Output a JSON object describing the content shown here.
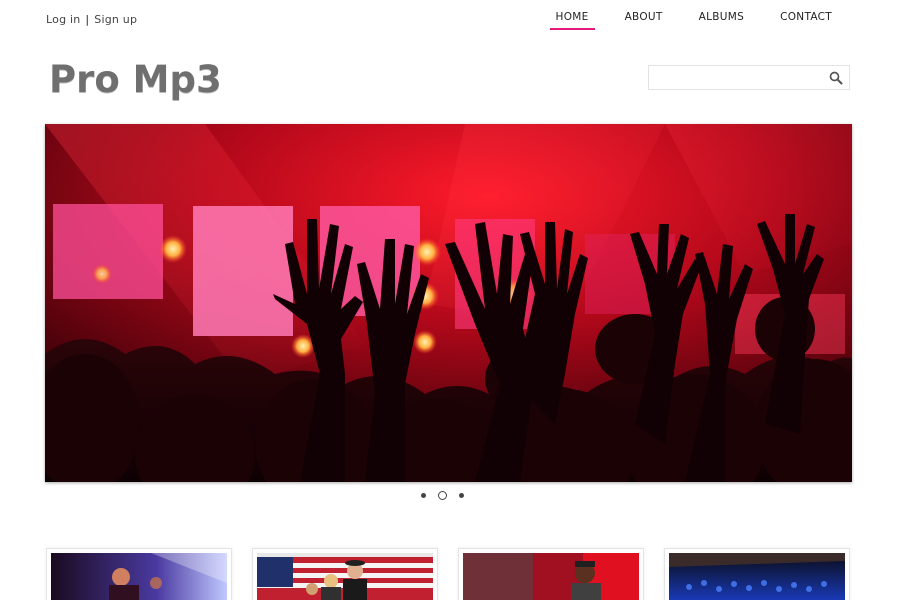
{
  "auth": {
    "login": "Log in",
    "separator": "|",
    "signup": "Sign up"
  },
  "nav": {
    "items": [
      {
        "label": "HOME",
        "active": true
      },
      {
        "label": "ABOUT",
        "active": false
      },
      {
        "label": "ALBUMS",
        "active": false
      },
      {
        "label": "CONTACT",
        "active": false
      }
    ]
  },
  "logo": {
    "text": "Pro Mp3"
  },
  "search": {
    "placeholder": "",
    "value": "",
    "icon": "search-icon"
  },
  "hero": {
    "image": "concert-crowd-raised-hands-red-lights",
    "slides": 3,
    "active_slide": 2
  },
  "albums": [
    {
      "image": "guitarist-on-stage-purple-lights"
    },
    {
      "image": "band-performing-with-american-flag"
    },
    {
      "image": "singer-with-red-backdrop"
    },
    {
      "image": "concert-crowd-blue-lights"
    }
  ],
  "colors": {
    "accent": "#e5197a",
    "logo": "#6f6f6f",
    "text": "#222222"
  }
}
